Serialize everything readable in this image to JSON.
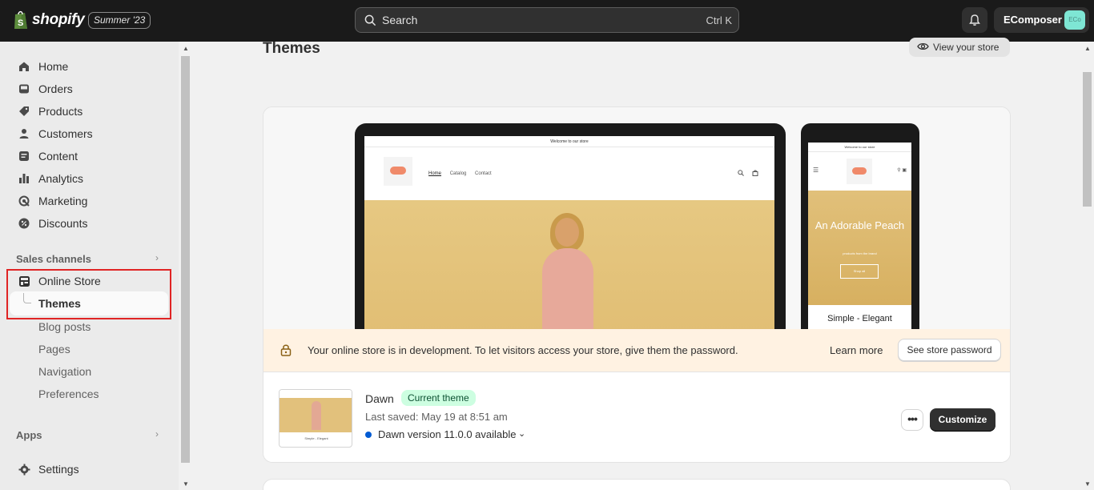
{
  "topbar": {
    "logo_text": "shopify",
    "edition": "Summer '23",
    "search_placeholder": "Search",
    "search_shortcut": "Ctrl K",
    "store_name": "EComposer",
    "store_avatar": "ECo"
  },
  "sidebar": {
    "items": [
      {
        "label": "Home",
        "icon": "home-icon"
      },
      {
        "label": "Orders",
        "icon": "inbox-icon"
      },
      {
        "label": "Products",
        "icon": "tag-icon"
      },
      {
        "label": "Customers",
        "icon": "person-icon"
      },
      {
        "label": "Content",
        "icon": "content-icon"
      },
      {
        "label": "Analytics",
        "icon": "bar-chart-icon"
      },
      {
        "label": "Marketing",
        "icon": "target-icon"
      },
      {
        "label": "Discounts",
        "icon": "discount-icon"
      }
    ],
    "sales_channels_label": "Sales channels",
    "online_store_label": "Online Store",
    "online_store_sub": [
      "Themes",
      "Blog posts",
      "Pages",
      "Navigation",
      "Preferences"
    ],
    "apps_label": "Apps",
    "settings_label": "Settings"
  },
  "main": {
    "title": "Themes",
    "view_store": "View your store",
    "preview": {
      "announcement": "Welcome to our store",
      "nav": [
        "Home",
        "Catalog",
        "Contact"
      ],
      "mobile_hero_title": "An Adorable Peach",
      "mobile_hero_sub": "products from the brand",
      "mobile_hero_button": "Shop all",
      "mobile_caption": "Simple - Elegant"
    },
    "banner": {
      "text": "Your online store is in development. To let visitors access your store, give them the password.",
      "learn_more": "Learn more",
      "button": "See store password"
    },
    "theme": {
      "name": "Dawn",
      "badge": "Current theme",
      "last_saved": "Last saved: May 19 at 8:51 am",
      "version": "Dawn version 11.0.0 available",
      "more": "•••",
      "customize": "Customize"
    }
  },
  "colors": {
    "topbar": "#1a1a1a",
    "sidebar": "#ebebeb",
    "highlight": "#e02424",
    "badge_bg": "#cdfee1",
    "banner_bg": "#fff2e2",
    "version_dot": "#005bd3"
  }
}
